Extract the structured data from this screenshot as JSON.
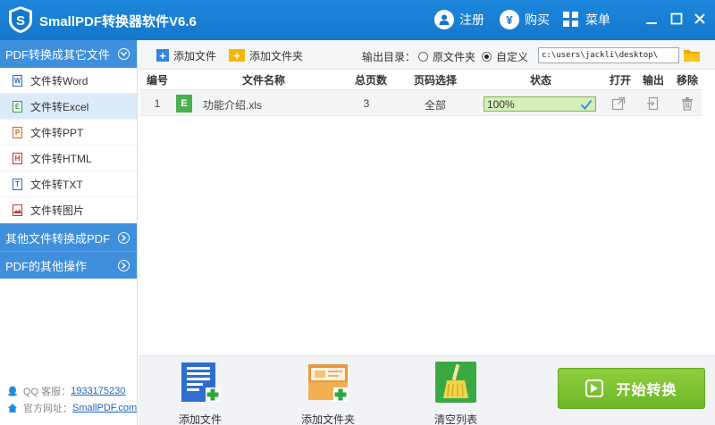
{
  "window": {
    "title": "SmallPDF转换器软件V6.6",
    "actions": {
      "register": "注册",
      "buy": "购买",
      "menu": "菜单"
    },
    "buy_glyph": "¥"
  },
  "sidebar": {
    "sections": [
      {
        "label": "PDF转换成其它文件",
        "state": "expanded"
      },
      {
        "label": "其他文件转换成PDF",
        "state": "collapsed"
      },
      {
        "label": "PDF的其他操作",
        "state": "collapsed"
      }
    ],
    "items": [
      {
        "label": "文件转Word",
        "letter": "W",
        "color": "#2b6fc2"
      },
      {
        "label": "文件转Excel",
        "letter": "E",
        "color": "#2e9b3f",
        "selected": true
      },
      {
        "label": "文件转PPT",
        "letter": "P",
        "color": "#d2691e"
      },
      {
        "label": "文件转HTML",
        "letter": "H",
        "color": "#c0392b"
      },
      {
        "label": "文件转TXT",
        "letter": "T",
        "color": "#2b6fc2"
      },
      {
        "label": "文件转图片",
        "letter": "",
        "color": "#c0392b"
      }
    ],
    "footer": {
      "qq_label": "QQ 客服：",
      "qq_value": "1933175230",
      "site_label": "官方网址：",
      "site_value": "SmallPDF.com"
    }
  },
  "toolbar": {
    "add_file": "添加文件",
    "add_folder": "添加文件夹",
    "output_label": "输出目录：",
    "radio_original": "原文件夹",
    "radio_custom": "自定义",
    "selected_radio": "custom",
    "path_value": "c:\\users\\jackli\\desktop\\"
  },
  "table": {
    "headers": [
      "编号",
      "文件名称",
      "总页数",
      "页码选择",
      "状态",
      "打开",
      "输出",
      "移除"
    ],
    "rows": [
      {
        "index": "1",
        "badge": "E",
        "name": "功能介绍.xls",
        "pages": "3",
        "range": "全部",
        "progress_text": "100%",
        "progress": 1.0
      }
    ]
  },
  "bottom": {
    "add_file": "添加文件",
    "add_folder": "添加文件夹",
    "clear_list": "清空列表",
    "start": "开始转换"
  },
  "colors": {
    "titlebar": "#1577cc",
    "sidebar_active": "#3f8fdc",
    "start_button": "#6eb625",
    "excel_green": "#4bb04b"
  }
}
